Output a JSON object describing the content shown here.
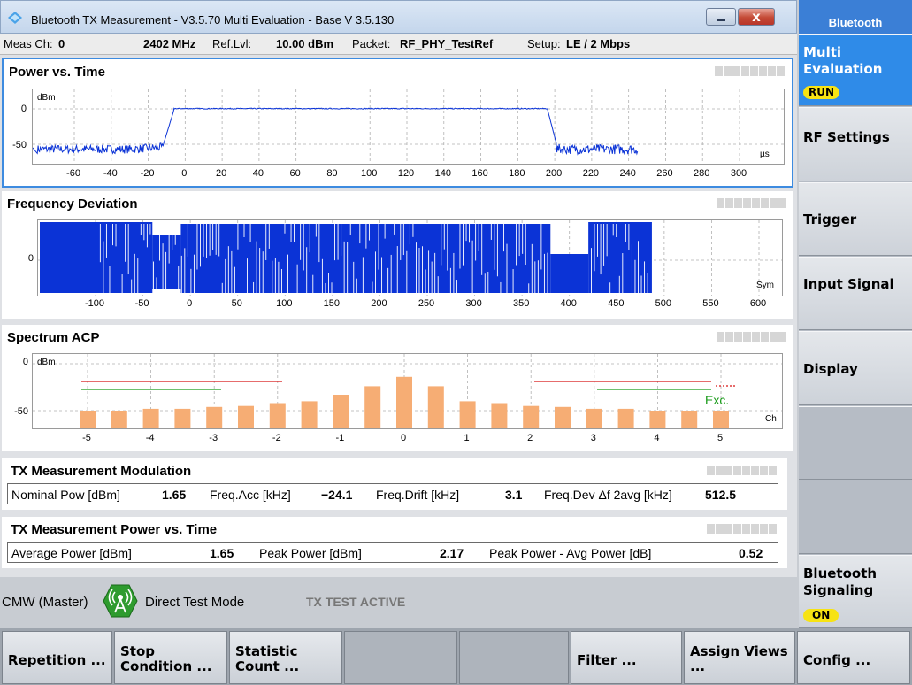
{
  "window": {
    "title": "Bluetooth TX Measurement  - V3.5.70 Multi Evaluation - Base V 3.5.130",
    "app_icon": "bluetooth-diamond-icon",
    "close_glyph": "x"
  },
  "infobar": {
    "meas_ch_label": "Meas Ch:",
    "meas_ch_value": "0",
    "frequency": "2402 MHz",
    "ref_lvl_label": "Ref.Lvl:",
    "ref_lvl_value": "10.00 dBm",
    "packet_label": "Packet:",
    "packet_value": "RF_PHY_TestRef",
    "setup_label": "Setup:",
    "setup_value": "LE / 2 Mbps"
  },
  "panels": {
    "power_vs_time": {
      "title": "Power vs. Time",
      "unit_y": "dBm",
      "unit_x": "µs",
      "y_ticks": [
        "0",
        "-50"
      ],
      "x_ticks": [
        "-60",
        "-40",
        "-20",
        "0",
        "20",
        "40",
        "60",
        "80",
        "100",
        "120",
        "140",
        "160",
        "180",
        "200",
        "220",
        "240",
        "260",
        "280",
        "300"
      ]
    },
    "frequency_deviation": {
      "title": "Frequency Deviation",
      "unit_x": "Sym",
      "y_ticks": [
        "0"
      ],
      "x_ticks": [
        "-100",
        "-50",
        "0",
        "50",
        "100",
        "150",
        "200",
        "250",
        "300",
        "350",
        "400",
        "450",
        "500",
        "550",
        "600"
      ]
    },
    "spectrum_acp": {
      "title": "Spectrum ACP",
      "unit_y": "dBm",
      "unit_x": "Ch",
      "y_ticks": [
        "0",
        "-50"
      ],
      "x_ticks": [
        "-5",
        "-4",
        "-3",
        "-2",
        "-1",
        "0",
        "1",
        "2",
        "3",
        "4",
        "5"
      ],
      "limit_label": "Exc."
    }
  },
  "modulation": {
    "title": "TX Measurement Modulation",
    "nominal_pow_label": "Nominal Pow [dBm]",
    "nominal_pow_value": "1.65",
    "freq_acc_label": "Freq.Acc [kHz]",
    "freq_acc_value": "−24.1",
    "freq_drift_label": "Freq.Drift [kHz]",
    "freq_drift_value": "3.1",
    "freq_dev_label": "Freq.Dev Δf 2avg [kHz]",
    "freq_dev_value": "512.5"
  },
  "power_summary": {
    "title": "TX Measurement Power vs. Time",
    "avg_power_label": "Average Power [dBm]",
    "avg_power_value": "1.65",
    "peak_power_label": "Peak Power [dBm]",
    "peak_power_value": "2.17",
    "peak_avg_label": "Peak Power - Avg Power [dB]",
    "peak_avg_value": "0.52"
  },
  "status": {
    "device": "CMW (Master)",
    "mode": "Direct Test Mode",
    "state": "TX TEST ACTIVE",
    "icon": "antenna-signal-icon"
  },
  "sidebar": {
    "header": "Bluetooth",
    "buttons": [
      {
        "label": "Multi Evaluation",
        "badge": "RUN",
        "active": true
      },
      {
        "label": "RF Settings"
      },
      {
        "label": "Trigger"
      },
      {
        "label": "Input Signal"
      },
      {
        "label": "Display"
      },
      {
        "label": ""
      },
      {
        "label": ""
      },
      {
        "label": "Bluetooth Signaling",
        "badge": "ON"
      }
    ]
  },
  "softkeys": [
    {
      "label": "Repetition ..."
    },
    {
      "label": "Stop Condition ..."
    },
    {
      "label": "Statistic Count ..."
    },
    {
      "label": ""
    },
    {
      "label": ""
    },
    {
      "label": "Filter ..."
    },
    {
      "label": "Assign Views ..."
    },
    {
      "label": "Config ..."
    }
  ],
  "acp_levels_dbm": [
    -50,
    -50,
    -48,
    -48,
    -46,
    -45,
    -42,
    -40,
    -33,
    -24,
    -14,
    -24,
    -40,
    -42,
    -45,
    -46,
    -48,
    -48,
    -50,
    -50,
    -50
  ],
  "colors": {
    "trace": "#0b33d6",
    "acp_bar": "#f6ad74",
    "limit_red": "#d81414",
    "limit_green": "#179a17",
    "active_softkey": "#2f8be8",
    "badge": "#f7e313"
  }
}
